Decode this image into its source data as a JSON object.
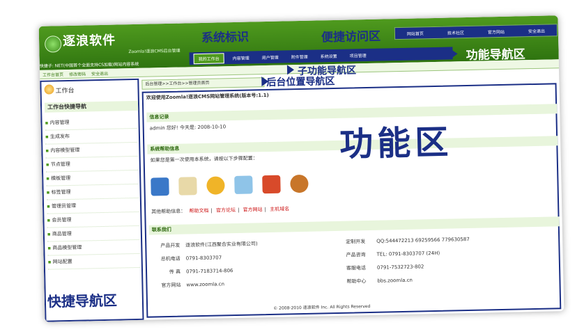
{
  "header": {
    "brand_name": "逐浪软件",
    "brand_sub": "Zoomla!逐浪CMS后台管理",
    "ticker": "快捷子: NET(中国首个全面支持CS加载)网站内容系统",
    "system_label": "系统标识",
    "quick_label": "便捷访问区",
    "quick_links": [
      "网站首页",
      "技术社区",
      "官方网站",
      "安全退出"
    ],
    "nav_tabs": [
      "我的工作台",
      "内容管理",
      "用户管理",
      "附件管理",
      "系统设置",
      "项目管理"
    ],
    "func_nav_label": "功能导航区"
  },
  "subnav": {
    "items": [
      "工作台首页",
      "修改密码",
      "安全退出"
    ],
    "label": "子功能导航区"
  },
  "breadcrumb": {
    "text": "后台管理>>工作台>>管理员首页",
    "label": "后台位置导航区"
  },
  "sidebar": {
    "title": "工作台",
    "quick_title": "工作台快捷导航",
    "items": [
      "内容管理",
      "生成发布",
      "内容模型管理",
      "节点管理",
      "模板管理",
      "标签管理",
      "管理员管理",
      "会员管理",
      "商品管理",
      "商品模型管理",
      "网站配置"
    ],
    "label": "快捷导航区"
  },
  "main": {
    "welcome": "欢迎使用Zoomla!逐浪CMS网站管理系统(版本号:1.1)",
    "info_title": "信息记录",
    "info_text": "admin 您好! 今天是: 2008-10-10",
    "help_title": "系统帮助信息",
    "help_text": "如果您是第一次使用本系统，请按以下步骤配置：",
    "help_links_label": "其他帮助信息：",
    "help_links": [
      "帮助文档",
      "官方论坛",
      "官方网站",
      "主机域名"
    ],
    "func_label": "功能区",
    "contact_title": "联系我们",
    "contact_rows": [
      [
        "产品开发",
        "逐浪软件(江西聚合实业有限公司)",
        "定制开发",
        "QQ:544472213  69259566  779630587"
      ],
      [
        "总机电话",
        "0791-8303707",
        "产品咨询",
        "TEL: 0791-8303707 (24H)"
      ],
      [
        "传 真",
        "0791-7183714-806",
        "客服电话",
        "0791-7532723-802"
      ],
      [
        "官方网站",
        "www.zoomla.cn",
        "帮助中心",
        "bbs.zoomla.cn"
      ]
    ],
    "footer": "© 2008-2010 逐浪软件 Inc. All Rights Reserved"
  }
}
